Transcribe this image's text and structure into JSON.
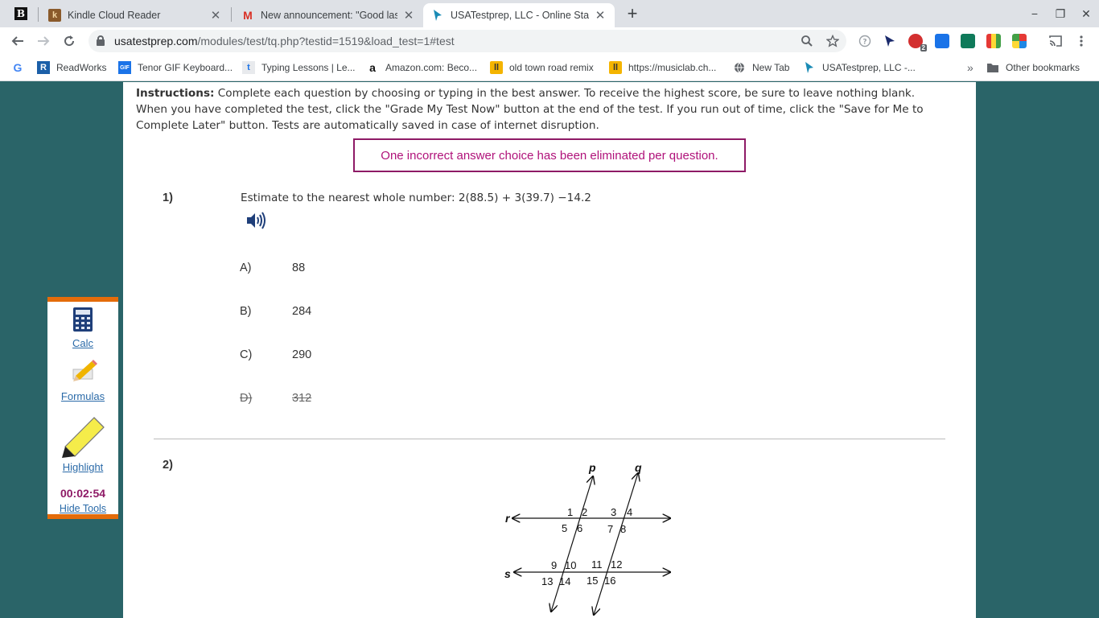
{
  "tabs": {
    "pinned_glyph": "B",
    "items": [
      {
        "title": "Kindle Cloud Reader",
        "favicon": "k"
      },
      {
        "title": "New announcement: \"Good last",
        "favicon": "M"
      },
      {
        "title": "USATestprep, LLC - Online State-S",
        "favicon": "cursor"
      }
    ],
    "close_glyph": "✕",
    "new_tab_glyph": "+"
  },
  "window": {
    "minimize": "−",
    "restore": "❐",
    "close": "✕"
  },
  "toolbar": {
    "url_host": "usatestprep.com",
    "url_path": "/modules/test/tq.php?testid=1519&load_test=1#test",
    "extension_badge": "2"
  },
  "bookmarks": [
    {
      "label": "",
      "favicon": "G"
    },
    {
      "label": "ReadWorks",
      "favicon": "R"
    },
    {
      "label": "Tenor GIF Keyboard...",
      "favicon": "GIF"
    },
    {
      "label": "Typing Lessons | Le...",
      "favicon": "t"
    },
    {
      "label": "Amazon.com: Beco...",
      "favicon": "a"
    },
    {
      "label": "old town road remix",
      "favicon": "ll"
    },
    {
      "label": "https://musiclab.ch...",
      "favicon": "ll"
    },
    {
      "label": "New Tab",
      "favicon": "globe"
    },
    {
      "label": "USATestprep, LLC -...",
      "favicon": "cursor"
    }
  ],
  "bookmarks_overflow": "»",
  "other_bookmarks": "Other bookmarks",
  "page": {
    "instructions_label": "Instructions:",
    "instructions_text": " Complete each question by choosing or typing in the best answer. To receive the highest score, be sure to leave nothing blank. When you have completed the test, click the \"Grade My Test Now\" button at the end of the test. If you run out of time, click the \"Save for Me to Complete Later\" button. Tests are automatically saved in case of internet disruption.",
    "notice": "One incorrect answer choice has been eliminated per question.",
    "q1": {
      "number": "1)",
      "text": "Estimate to the nearest whole number: 2(88.5) + 3(39.7) −14.2",
      "choices": [
        {
          "letter": "A)",
          "value": "88",
          "eliminated": false
        },
        {
          "letter": "B)",
          "value": "284",
          "eliminated": false
        },
        {
          "letter": "C)",
          "value": "290",
          "eliminated": false
        },
        {
          "letter": "D)",
          "value": "312",
          "eliminated": true
        }
      ]
    },
    "q2": {
      "number": "2)",
      "figure": {
        "line_labels": {
          "p": "p",
          "q": "q",
          "r": "r",
          "s": "s"
        },
        "angles": [
          "1",
          "2",
          "3",
          "4",
          "5",
          "6",
          "7",
          "8",
          "9",
          "10",
          "11",
          "12",
          "13",
          "14",
          "15",
          "16"
        ]
      }
    }
  },
  "tools": {
    "calc": "Calc",
    "formulas": "Formulas",
    "highlight": "Highlight",
    "timer": "00:02:54",
    "hide": "Hide Tools"
  },
  "colors": {
    "background": "#2a6468",
    "notice_border": "#8e1a66",
    "notice_text": "#b0127a",
    "tools_accent": "#e46c0a",
    "timer": "#8e1a66",
    "link": "#2a6aa8"
  }
}
